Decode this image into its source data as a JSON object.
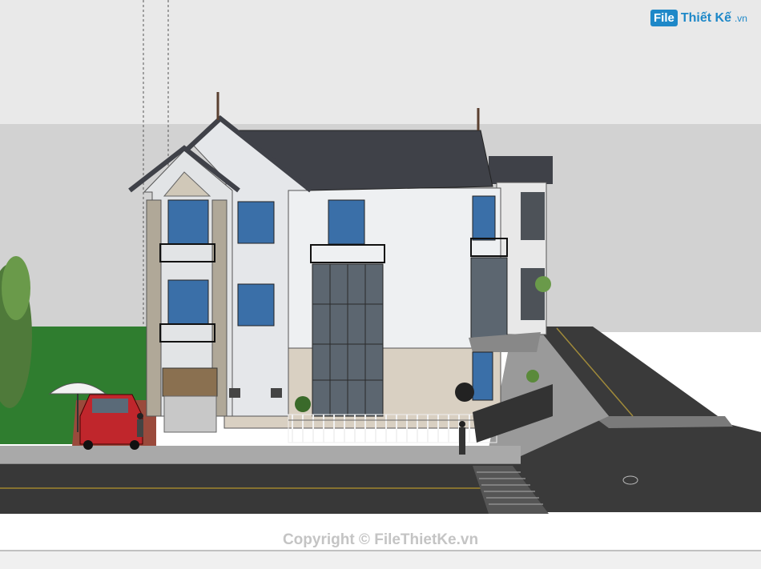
{
  "watermark": {
    "logo_box": "File",
    "logo_name": "Thiết Kế",
    "logo_tld": ".vn",
    "copyright": "Copyright © FileThietKe.vn"
  },
  "colors": {
    "sky": "#e6e6e6",
    "ground_band": "#cfcfcf",
    "lawn": "#2f7d2f",
    "road": "#3a3a3a",
    "sidewalk": "#a9a9a9",
    "roof": "#3f4148",
    "wall": "#eef0f2",
    "stone": "#a39a8c",
    "glass": "#5c6670",
    "car": "#c0262c",
    "umbrella": "#f2f2f2"
  },
  "icons": [
    "tree-icon",
    "car-icon",
    "umbrella-icon",
    "person-icon",
    "manhole-icon"
  ]
}
